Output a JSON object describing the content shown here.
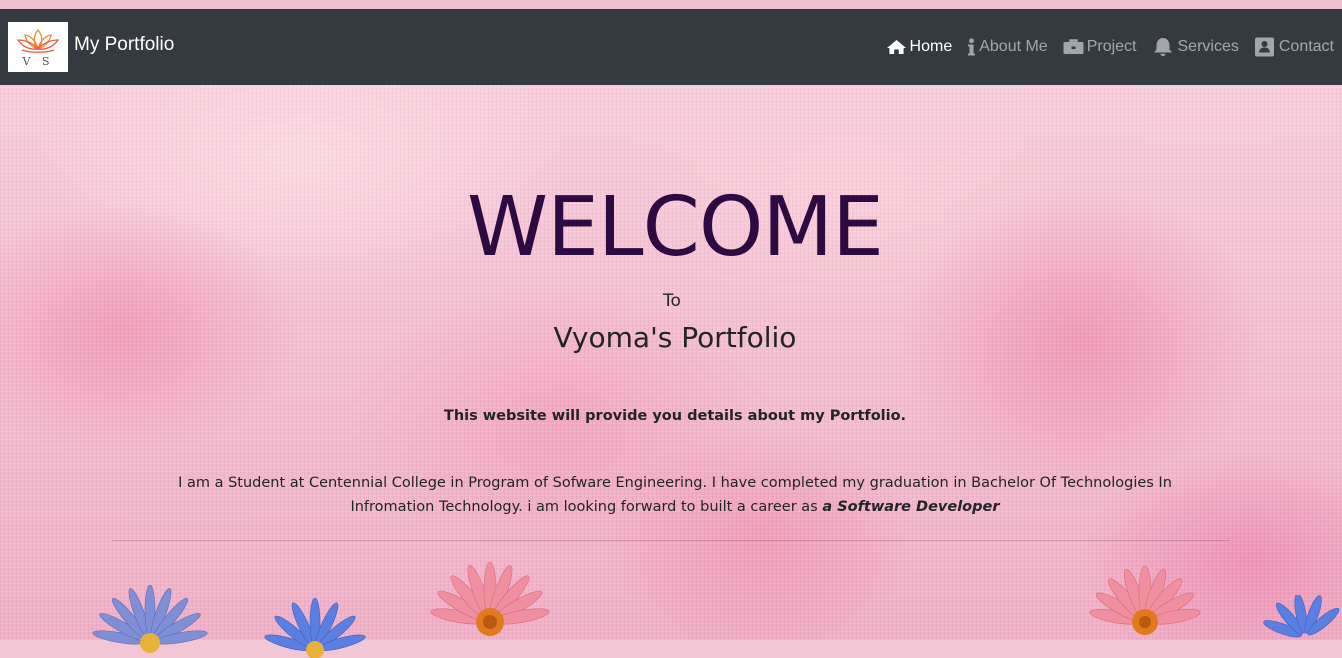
{
  "navbar": {
    "logo_initials": "V S",
    "brand": "My Portfolio",
    "items": [
      {
        "label": "Home",
        "icon": "home-icon",
        "active": true
      },
      {
        "label": "About Me",
        "icon": "info-icon",
        "active": false
      },
      {
        "label": "Project",
        "icon": "briefcase-icon",
        "active": false
      },
      {
        "label": "Services",
        "icon": "bell-icon",
        "active": false
      },
      {
        "label": "Contact",
        "icon": "contact-card-icon",
        "active": false
      }
    ]
  },
  "hero": {
    "title": "WELCOME",
    "to": "To",
    "subtitle": "Vyoma's Portfolio",
    "lead": "This website will provide you details about my Portfolio.",
    "description": "I am a Student at Centennial College in Program of Sofware Engineering. I have completed my graduation in Bachelor Of Technologies In Infromation Technology. i am looking forward to built a career as ",
    "description_emphasis": "a Software Developer"
  },
  "colors": {
    "navbar_bg": "#343a40",
    "title_color": "#2c0b43",
    "text_color": "#212529",
    "nav_active": "#ffffff",
    "nav_inactive": "rgba(255,255,255,0.55)"
  }
}
